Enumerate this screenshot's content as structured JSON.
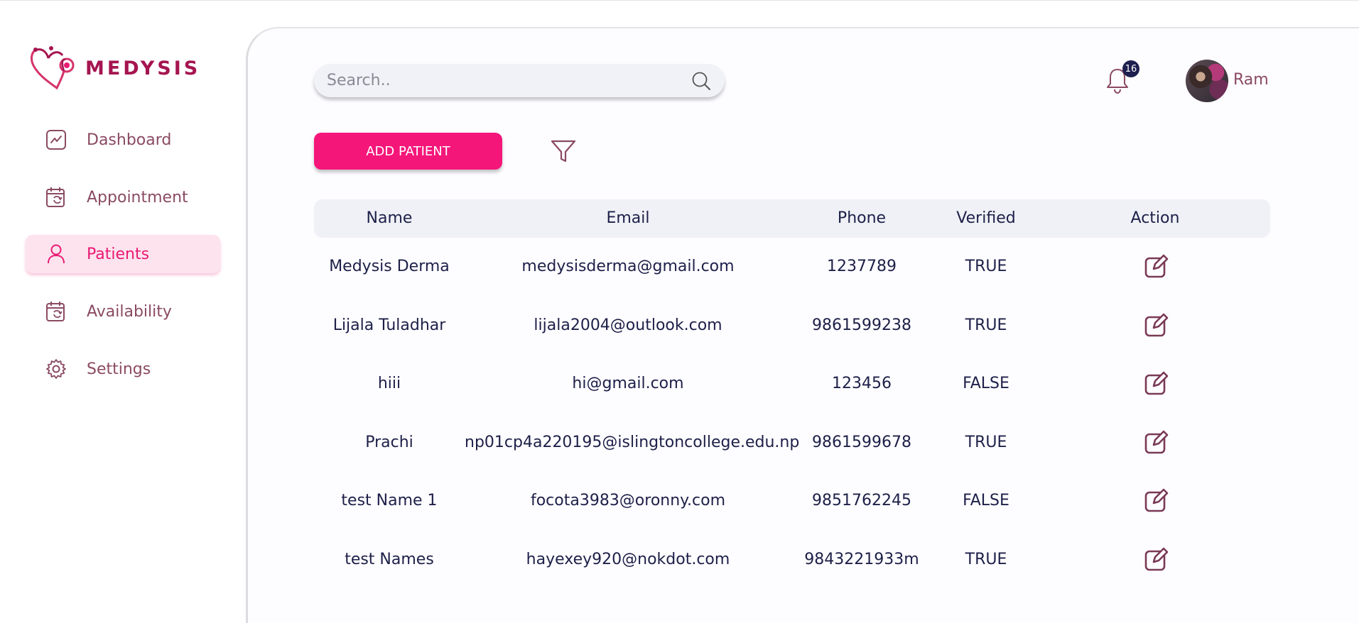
{
  "brand": {
    "name": "MEDYSIS",
    "color": "#a51550"
  },
  "sidebar": {
    "items": [
      {
        "label": "Dashboard",
        "icon": "chart-line-icon",
        "active": false
      },
      {
        "label": "Appointment",
        "icon": "calendar-sync-icon",
        "active": false
      },
      {
        "label": "Patients",
        "icon": "user-icon",
        "active": true
      },
      {
        "label": "Availability",
        "icon": "calendar-sync-icon",
        "active": false
      },
      {
        "label": "Settings",
        "icon": "gear-icon",
        "active": false
      }
    ]
  },
  "header": {
    "search_placeholder": "Search..",
    "notification_count": "16",
    "username": "Ram"
  },
  "toolbar": {
    "add_label": "ADD PATIENT"
  },
  "table": {
    "columns": [
      "Name",
      "Email",
      "Phone",
      "Verified",
      "Action"
    ],
    "rows": [
      {
        "name": "Medysis Derma",
        "email": "medysisderma@gmail.com",
        "phone": "1237789",
        "verified": "TRUE"
      },
      {
        "name": "Lijala Tuladhar",
        "email": "lijala2004@outlook.com",
        "phone": "9861599238",
        "verified": "TRUE"
      },
      {
        "name": "hiii",
        "email": "hi@gmail.com",
        "phone": "123456",
        "verified": "FALSE"
      },
      {
        "name": "Prachi",
        "email": "np01cp4a220195@islingtoncollege.edu.np",
        "phone": "9861599678",
        "verified": "TRUE"
      },
      {
        "name": "test Name 1",
        "email": "focota3983@oronny.com",
        "phone": "9851762245",
        "verified": "FALSE"
      },
      {
        "name": "test Names",
        "email": "hayexey920@nokdot.com",
        "phone": "9843221933m",
        "verified": "TRUE"
      }
    ]
  },
  "colors": {
    "accent": "#f5167a",
    "nav_text": "#8a4a62",
    "active_bg": "#fde3ee",
    "table_text": "#1d2048",
    "header_bg": "#eff1f6"
  }
}
